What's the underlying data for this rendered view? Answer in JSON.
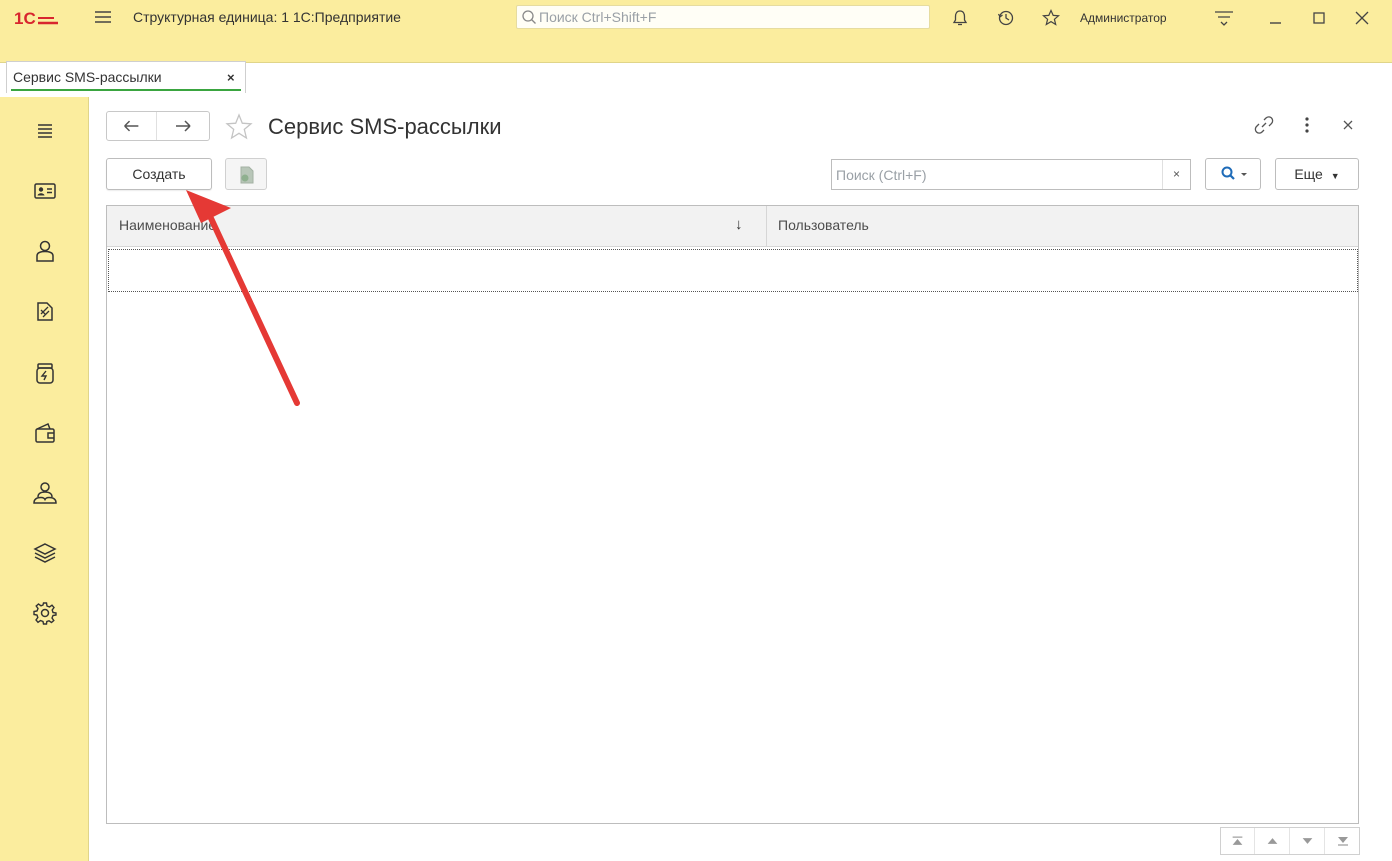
{
  "window": {
    "app_title": "Структурная единица: 1 1С:Предприятие",
    "search_placeholder": "Поиск Ctrl+Shift+F",
    "user_name": "Администратор"
  },
  "tabs": [
    {
      "label": "Сервис SMS-рассылки",
      "close": "×"
    }
  ],
  "sidebar": {
    "items": [
      {
        "icon": "menu-icon"
      },
      {
        "icon": "contact-card-icon"
      },
      {
        "icon": "person-icon"
      },
      {
        "icon": "documents-icon"
      },
      {
        "icon": "money-jar-icon"
      },
      {
        "icon": "wallet-icon"
      },
      {
        "icon": "people-icon"
      },
      {
        "icon": "layers-icon"
      },
      {
        "icon": "settings-icon"
      }
    ]
  },
  "form": {
    "title": "Сервис SMS-рассылки",
    "toolbar": {
      "create_label": "Создать",
      "search_placeholder": "Поиск (Ctrl+F)",
      "clear_label": "×",
      "more_label": "Еще"
    },
    "table": {
      "columns": [
        {
          "label": "Наименование",
          "sort": "↓"
        },
        {
          "label": "Пользователь"
        }
      ],
      "rows": []
    }
  },
  "colors": {
    "chrome_yellow": "#fbed9e",
    "tab_accent": "#3aa540",
    "annotation_arrow": "#e53935",
    "logo_red": "#d8262e"
  }
}
